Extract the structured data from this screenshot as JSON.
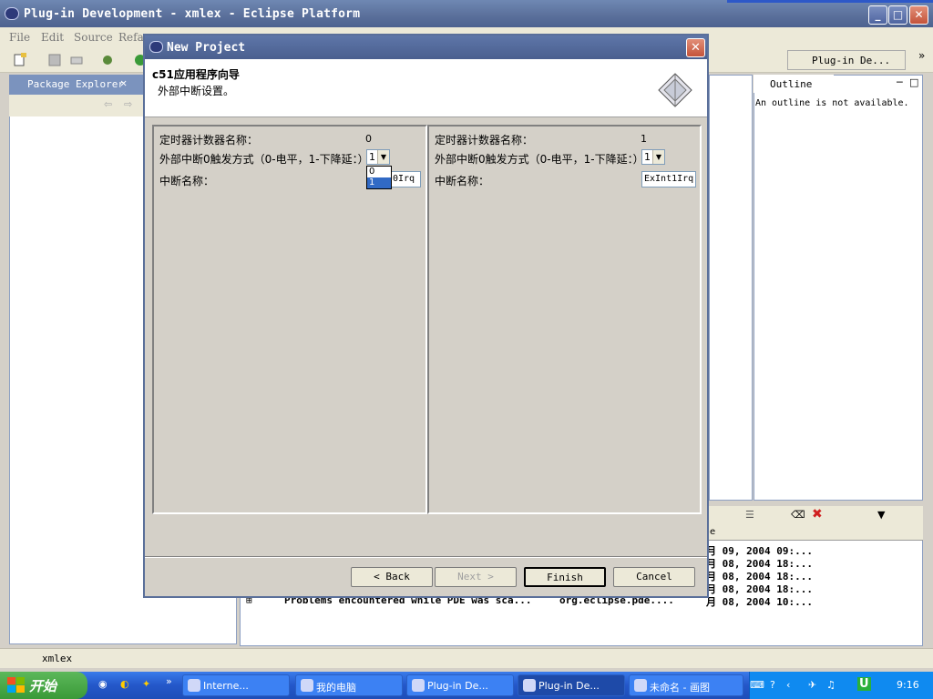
{
  "window": {
    "title": "Plug-in Development - xmlex - Eclipse Platform"
  },
  "menu": [
    "File",
    "Edit",
    "Source",
    "Refa"
  ],
  "perspective": {
    "label": "Plug-in De..."
  },
  "package_explorer": {
    "tab": "Package Explorer"
  },
  "outline": {
    "tab": "Outline",
    "message": "An outline is not available."
  },
  "problems": {
    "column_header": "e",
    "rows": [
      {
        "date": "月 09, 2004 09:..."
      },
      {
        "date": "月 08, 2004 18:..."
      },
      {
        "date": "月 08, 2004 18:..."
      },
      {
        "date": "月 08, 2004 18:..."
      },
      {
        "description": "Problems encountered while PDE was sca...",
        "resource": "org.eclipse.pde....",
        "date": "月 08, 2004 10:..."
      }
    ]
  },
  "status": {
    "text": "xmlex"
  },
  "dialog": {
    "title": "New Project",
    "heading": "c51应用程序向导",
    "description": "外部中断设置。",
    "left": {
      "counter_label": "定时器计数器名称：",
      "counter_value": "0",
      "trigger_label": "外部中断0触发方式（0-电平，1-下降延：）",
      "trigger_value": "1",
      "name_label": "中断名称：",
      "name_value": "ExInt0Irq",
      "name_visible": "0Irq"
    },
    "right": {
      "counter_label": "定时器计数器名称：",
      "counter_value": "1",
      "trigger_label": "外部中断0触发方式（0-电平，1-下降延：）",
      "trigger_value": "1",
      "name_label": "中断名称：",
      "name_value": "ExInt1Irq"
    },
    "dropdown_options": [
      "0",
      "1"
    ],
    "buttons": {
      "back": "< Back",
      "next": "Next >",
      "finish": "Finish",
      "cancel": "Cancel"
    }
  },
  "taskbar": {
    "start": "开始",
    "tasks": [
      "Interne...",
      "我的电脑",
      "Plug-in De...",
      "Plug-in De...",
      "未命名 - 画图"
    ],
    "clock": "9:16"
  }
}
